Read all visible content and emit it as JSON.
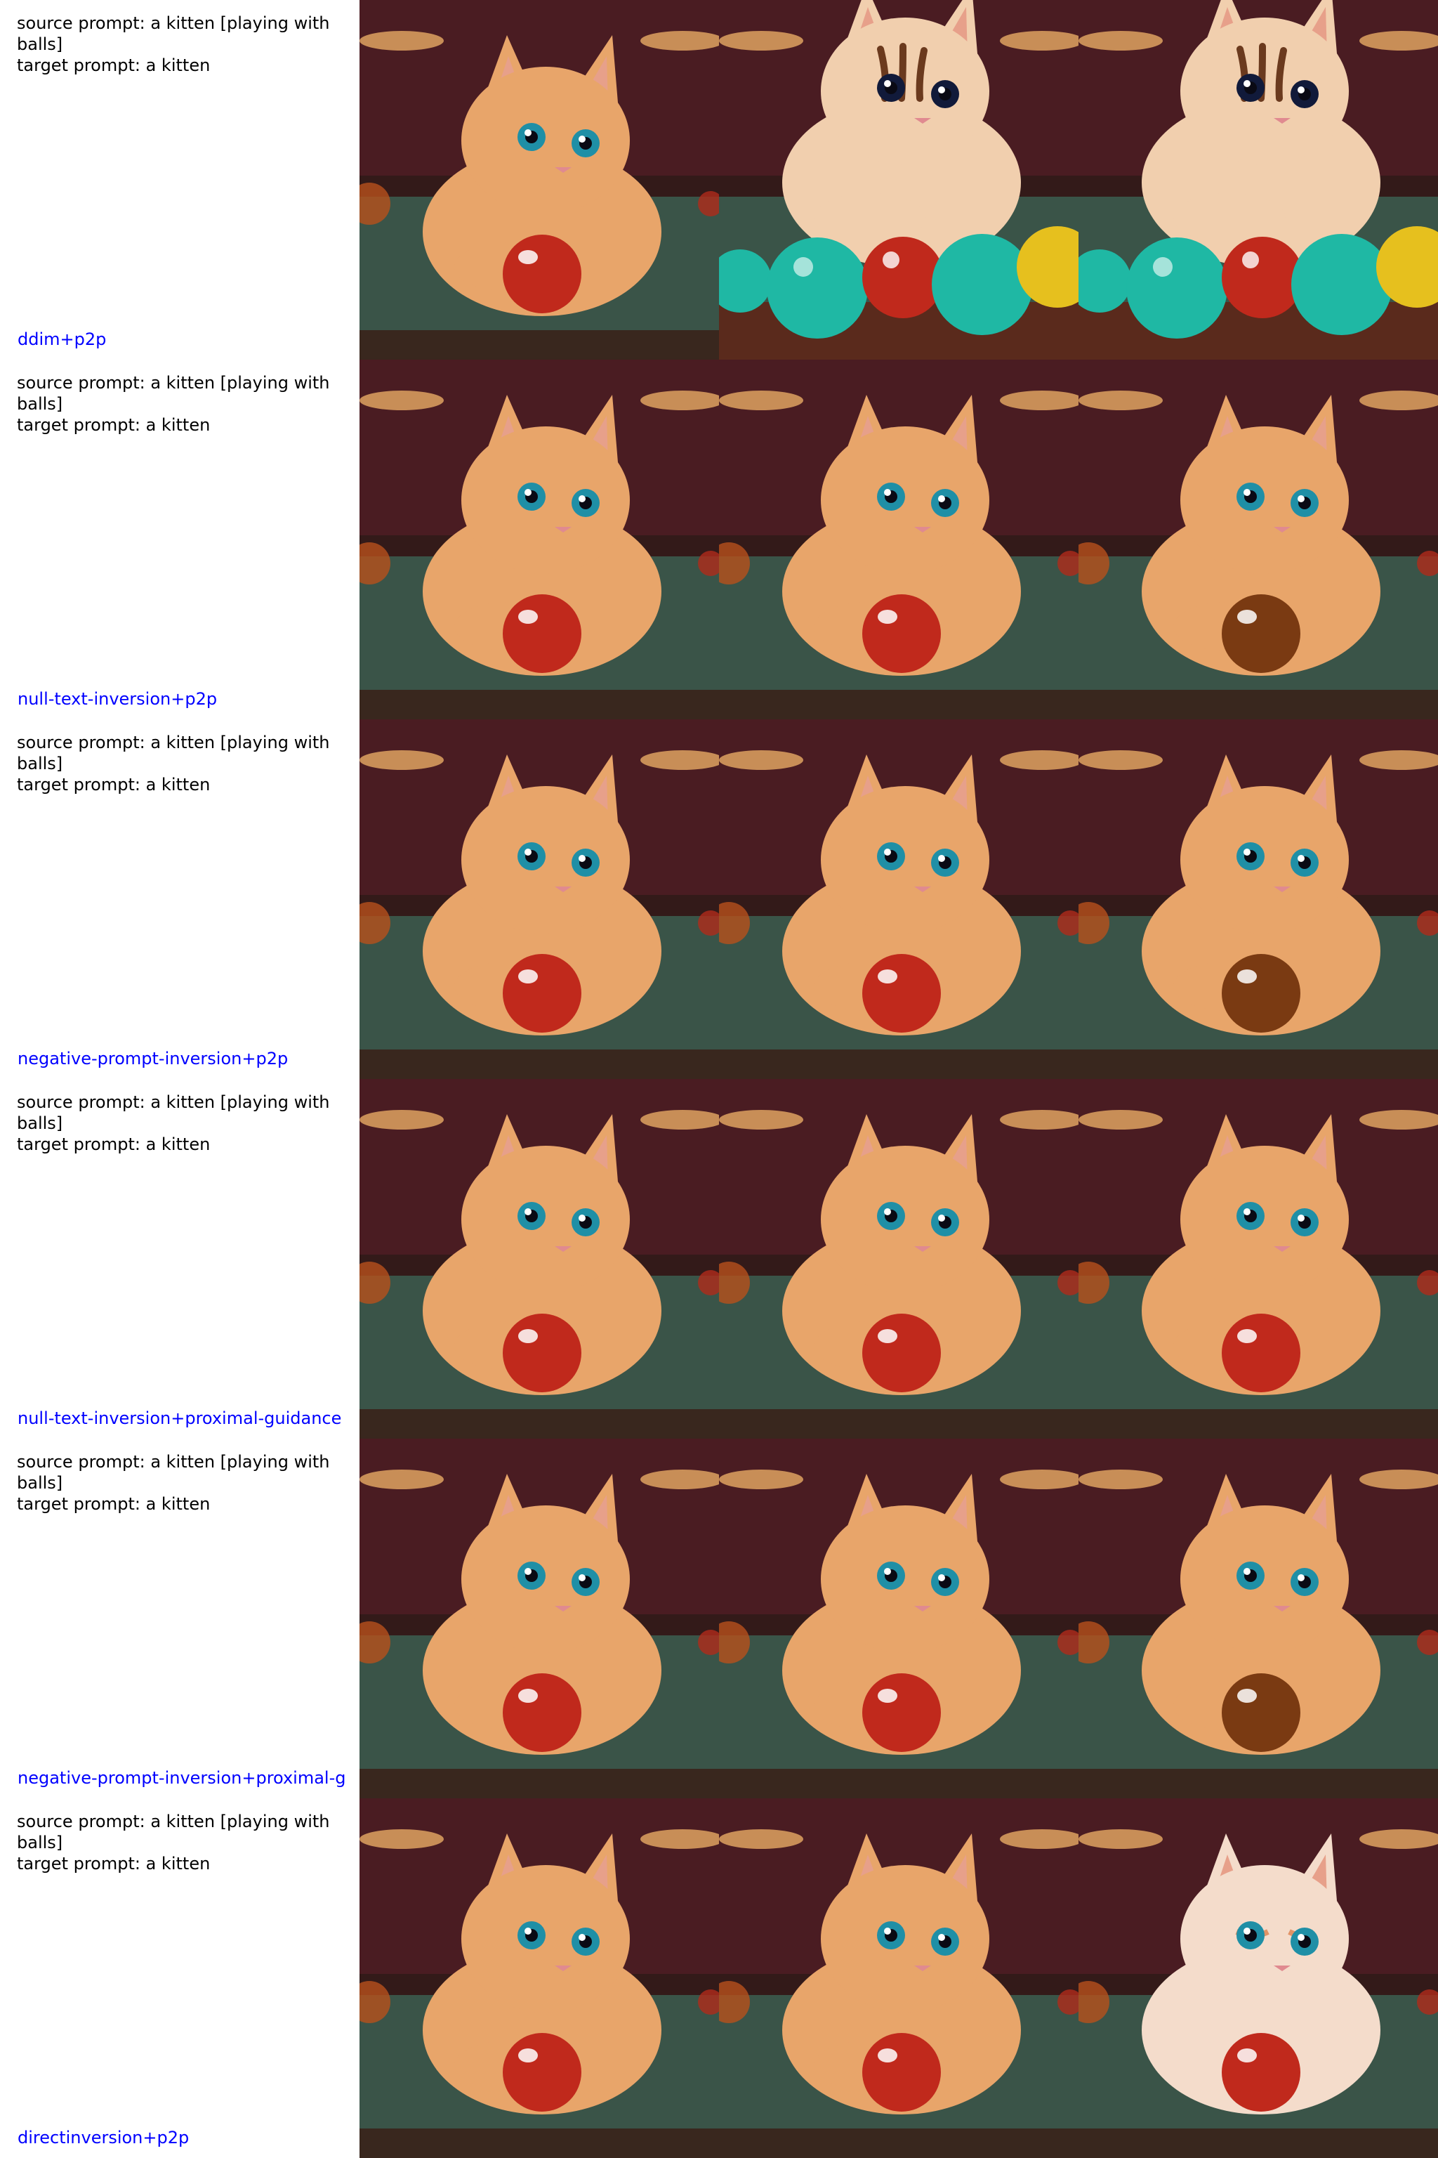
{
  "rows": [
    {
      "prompt_text": "source prompt: a kitten [playing with\nballs]\ntarget prompt: a kitten",
      "method": "ddim+p2p",
      "cells": [
        {
          "variant": "orange",
          "ball": "red"
        },
        {
          "variant": "tabby",
          "ball": "multi"
        },
        {
          "variant": "tabby",
          "ball": "multi"
        }
      ]
    },
    {
      "prompt_text": "source prompt: a kitten [playing with\nballs]\ntarget prompt: a kitten",
      "method": "null-text-inversion+p2p",
      "cells": [
        {
          "variant": "orange",
          "ball": "red"
        },
        {
          "variant": "orange",
          "ball": "red"
        },
        {
          "variant": "orange",
          "ball": "brown"
        }
      ]
    },
    {
      "prompt_text": "source prompt: a kitten [playing with\nballs]\ntarget prompt: a kitten",
      "method": "negative-prompt-inversion+p2p",
      "cells": [
        {
          "variant": "orange",
          "ball": "red"
        },
        {
          "variant": "orange",
          "ball": "red"
        },
        {
          "variant": "orange",
          "ball": "brown"
        }
      ]
    },
    {
      "prompt_text": "source prompt: a kitten [playing with\nballs]\ntarget prompt: a kitten",
      "method": "null-text-inversion+proximal-guidance",
      "cells": [
        {
          "variant": "orange",
          "ball": "red"
        },
        {
          "variant": "orange",
          "ball": "red"
        },
        {
          "variant": "orange",
          "ball": "red"
        }
      ]
    },
    {
      "prompt_text": "source prompt: a kitten [playing with\nballs]\ntarget prompt: a kitten",
      "method": "negative-prompt-inversion+proximal-g",
      "cells": [
        {
          "variant": "orange",
          "ball": "red"
        },
        {
          "variant": "orange",
          "ball": "red"
        },
        {
          "variant": "orange",
          "ball": "brown"
        }
      ]
    },
    {
      "prompt_text": "source prompt: a kitten [playing with\nballs]\ntarget prompt: a kitten",
      "method": "directinversion+p2p",
      "cells": [
        {
          "variant": "orange",
          "ball": "red"
        },
        {
          "variant": "orange",
          "ball": "red"
        },
        {
          "variant": "pale",
          "ball": "red"
        }
      ]
    }
  ],
  "colors": {
    "prompt_text": "#000000",
    "method_text": "#0000ff",
    "table_felt": "#3a5448",
    "background": "#4a1c22",
    "lamp": "#f3b46a",
    "fur_orange": "#e8a56a",
    "fur_tabby": "#f1cfae",
    "fur_pale": "#f4dccb",
    "eye_blue": "#1f8fa6",
    "ball_red": "#c0291c",
    "ball_brown": "#7a3a12",
    "ball_teal": "#1fb8a4",
    "ball_yellow": "#e6c01e"
  }
}
